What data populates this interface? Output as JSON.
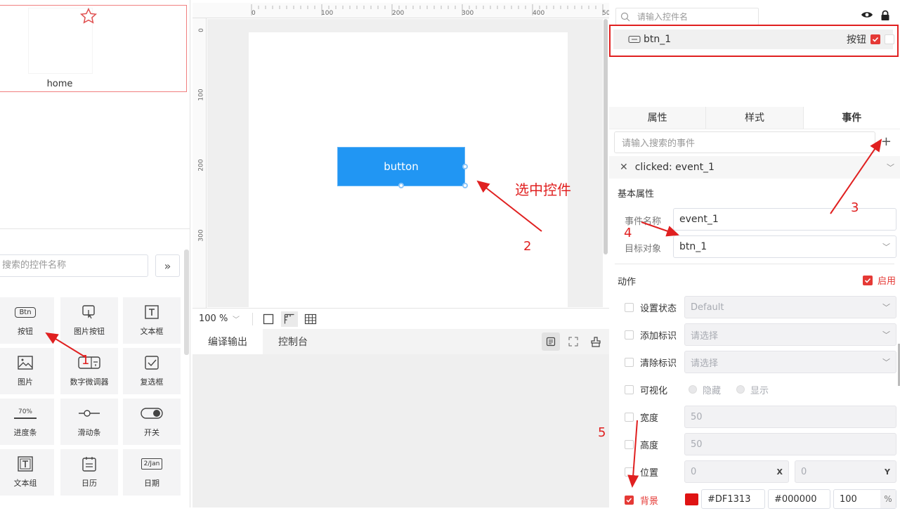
{
  "left": {
    "page_name": "home",
    "search_placeholder": "搜索的控件名称",
    "controls": [
      {
        "label": "按钮",
        "icon": "btn-icon"
      },
      {
        "label": "图片按钮",
        "icon": "image-button-icon"
      },
      {
        "label": "文本框",
        "icon": "text-box-icon"
      },
      {
        "label": "图片",
        "icon": "image-icon"
      },
      {
        "label": "数字微调器",
        "icon": "spinner-icon"
      },
      {
        "label": "复选框",
        "icon": "checkbox-icon"
      },
      {
        "label": "进度条",
        "icon": "progress-icon"
      },
      {
        "label": "滑动条",
        "icon": "slider-icon"
      },
      {
        "label": "开关",
        "icon": "switch-icon"
      },
      {
        "label": "文本组",
        "icon": "text-group-icon"
      },
      {
        "label": "日历",
        "icon": "calendar-icon"
      },
      {
        "label": "日期",
        "icon": "date-icon"
      }
    ],
    "btn_icon_text": "Btn",
    "progress_text": "70%",
    "date_icon_text": "2/Jan"
  },
  "center": {
    "ruler_top": [
      "0",
      "100",
      "200",
      "300",
      "400",
      "50"
    ],
    "ruler_left": [
      "0",
      "100",
      "200",
      "300"
    ],
    "widget_label": "button",
    "zoom": "100 %",
    "output_tabs": [
      "编译输出",
      "控制台"
    ]
  },
  "right": {
    "layer_search_placeholder": "请输入控件名",
    "layer": {
      "name": "btn_1",
      "type": "按钮"
    },
    "tabs": [
      "属性",
      "样式",
      "事件"
    ],
    "event_search_placeholder": "请输入搜索的事件",
    "event_header": "clicked: event_1",
    "basic_title": "基本属性",
    "event_name_label": "事件名称",
    "event_name_value": "event_1",
    "target_label": "目标对象",
    "target_value": "btn_1",
    "actions_title": "动作",
    "enable_label": "启用",
    "actions": {
      "set_state": {
        "label": "设置状态",
        "value": "Default"
      },
      "add_tag": {
        "label": "添加标识",
        "value": "请选择"
      },
      "clear_tag": {
        "label": "清除标识",
        "value": "请选择"
      },
      "visible": {
        "label": "可视化",
        "hide": "隐藏",
        "show": "显示"
      },
      "width": {
        "label": "宽度",
        "value": "50"
      },
      "height": {
        "label": "高度",
        "value": "50"
      },
      "position": {
        "label": "位置",
        "x": "0",
        "x_unit": "X",
        "y": "0",
        "y_unit": "Y"
      },
      "background": {
        "label": "背景",
        "color1": "#DF1313",
        "color2": "#000000",
        "opacity": "100",
        "unit": "%"
      }
    }
  },
  "annotations": {
    "select_control": "选中控件",
    "n1": "1",
    "n2": "2",
    "n3": "3",
    "n4": "4",
    "n5": "5"
  },
  "colors": {
    "accent": "#e53935",
    "widget": "#2196f3",
    "swatch": "#DF1313"
  }
}
